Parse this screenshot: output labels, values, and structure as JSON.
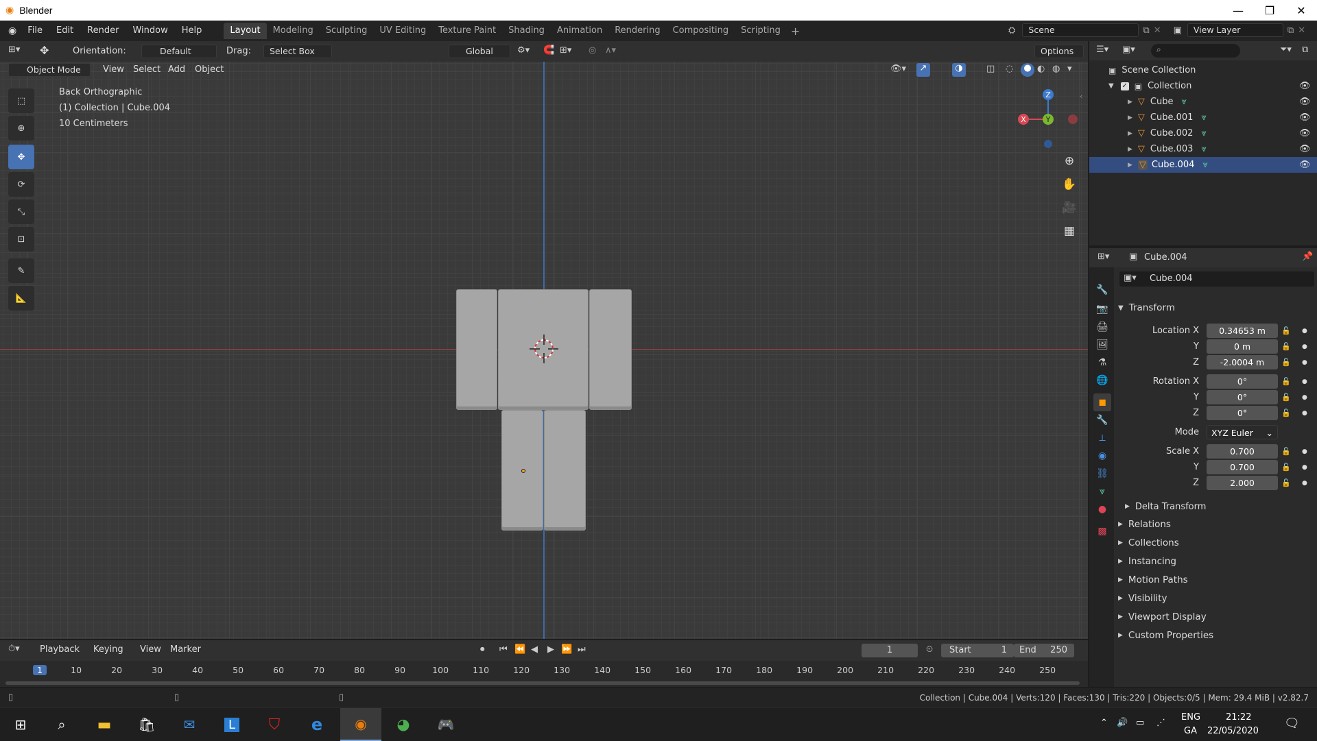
{
  "app": {
    "title": "Blender"
  },
  "menu": [
    "File",
    "Edit",
    "Render",
    "Window",
    "Help"
  ],
  "workspaces": [
    "Layout",
    "Modeling",
    "Sculpting",
    "UV Editing",
    "Texture Paint",
    "Shading",
    "Animation",
    "Rendering",
    "Compositing",
    "Scripting"
  ],
  "scene": "Scene",
  "view_layer": "View Layer",
  "toolhdr": {
    "orientation_label": "Orientation:",
    "orientation_value": "Default",
    "drag_label": "Drag:",
    "drag_value": "Select Box",
    "transform_orientation": "Global",
    "options": "Options"
  },
  "viewhdr": {
    "mode": "Object Mode",
    "items": [
      "View",
      "Select",
      "Add",
      "Object"
    ]
  },
  "overlay": {
    "line1": "Back Orthographic",
    "line2": "(1) Collection | Cube.004",
    "line3": "10 Centimeters"
  },
  "gizmo": {
    "x": "X",
    "y": "Y",
    "z": "Z"
  },
  "outliner": {
    "root": "Scene Collection",
    "collection": "Collection",
    "objects": [
      "Cube",
      "Cube.001",
      "Cube.002",
      "Cube.003",
      "Cube.004"
    ]
  },
  "properties": {
    "header_object": "Cube.004",
    "object_name": "Cube.004",
    "transform": "Transform",
    "location": {
      "label": "Location X",
      "x": "0.34653 m",
      "y": "0 m",
      "z": "-2.0004 m"
    },
    "rotation": {
      "label": "Rotation X",
      "x": "0°",
      "y": "0°",
      "z": "0°"
    },
    "mode_label": "Mode",
    "mode_value": "XYZ Euler",
    "scale": {
      "label": "Scale X",
      "x": "0.700",
      "y": "0.700",
      "z": "2.000"
    },
    "axis_y": "Y",
    "axis_z": "Z",
    "subpanels": [
      "Delta Transform",
      "Relations",
      "Collections",
      "Instancing",
      "Motion Paths",
      "Visibility",
      "Viewport Display",
      "Custom Properties"
    ]
  },
  "timeline": {
    "menus": [
      "Playback",
      "Keying",
      "View",
      "Marker"
    ],
    "current_frame": "1",
    "start_label": "Start",
    "start": "1",
    "end_label": "End",
    "end": "250",
    "ticks": [
      "1",
      "10",
      "20",
      "30",
      "40",
      "50",
      "60",
      "70",
      "80",
      "90",
      "100",
      "110",
      "120",
      "130",
      "140",
      "150",
      "160",
      "170",
      "180",
      "190",
      "200",
      "210",
      "220",
      "230",
      "240",
      "250"
    ]
  },
  "status": "Collection | Cube.004 | Verts:120 | Faces:130 | Tris:220 | Objects:0/5 | Mem: 29.4 MiB | v2.82.7",
  "taskbar": {
    "lang1": "ENG",
    "lang2": "GA",
    "time": "21:22",
    "date": "22/05/2020"
  }
}
